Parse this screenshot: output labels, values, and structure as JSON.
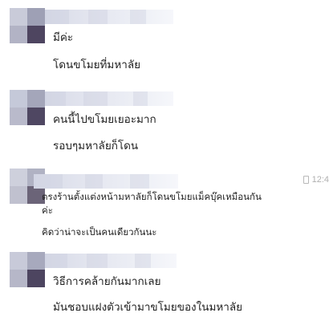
{
  "messages": [
    {
      "lines": [
        "มีค่ะ",
        "โดนขโมยที่มหาลัย"
      ]
    },
    {
      "lines": [
        "คนนี้ไปขโมยเยอะมาก",
        "รอบๆมหาลัยก็โดน"
      ]
    },
    {
      "timestamp": "12:4",
      "lines": [
        "ตรงร้านตั้งแต่งหน้ามหาลัยก็โดนขโมยแม็คบุ๊คเหมือนกัน",
        "ค่ะ",
        "คิดว่าน่าจะเป็นคนเดียวกันนะ"
      ]
    },
    {
      "lines": [
        "วิธีการคล้ายกันมากเลย",
        "มันชอบแฝงตัวเข้ามาขโมยของในมหาลัย"
      ]
    }
  ],
  "colors": {
    "background": "#ffffff",
    "text": "#1f1f1f",
    "timestamp": "#b0b0b0"
  },
  "icons": {
    "phone": "phone-icon"
  }
}
